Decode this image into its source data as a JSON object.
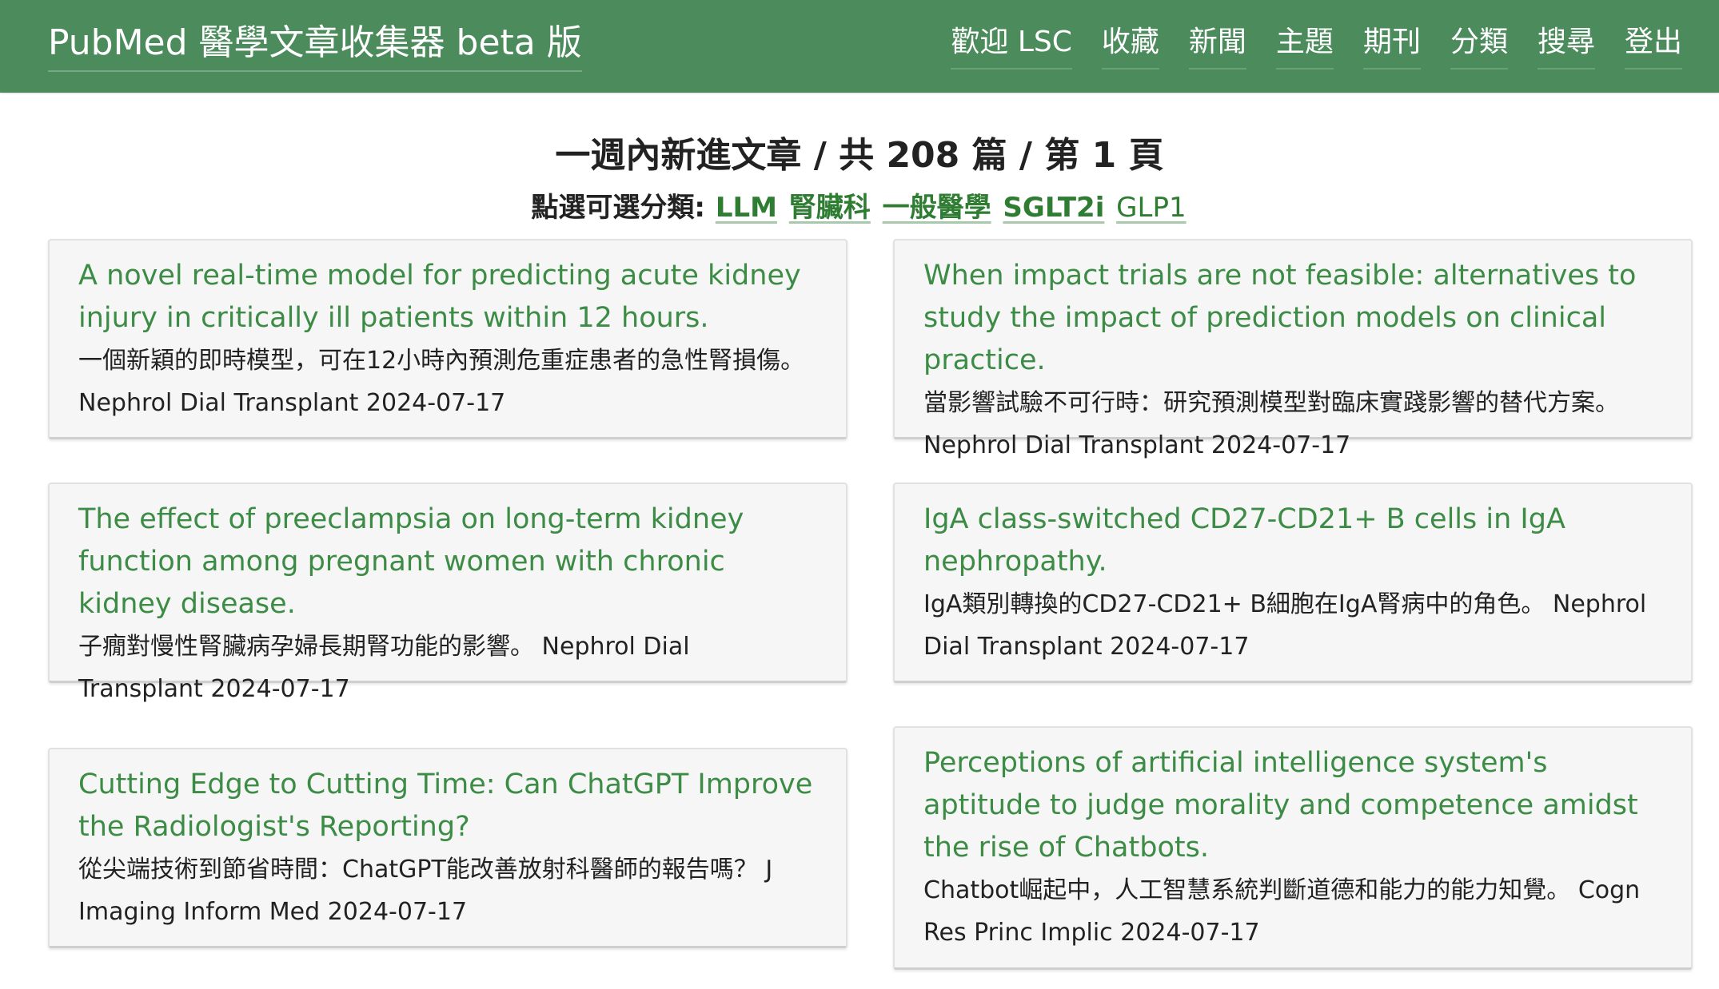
{
  "navbar": {
    "brand": "PubMed 醫學文章收集器 beta 版",
    "links": [
      "歡迎 LSC",
      "收藏",
      "新聞",
      "主題",
      "期刊",
      "分類",
      "搜尋",
      "登出"
    ]
  },
  "main": {
    "title": "一週內新進文章 / 共 208 篇 / 第 1 頁",
    "category_prefix": "點選可選分類:",
    "categories": [
      "LLM",
      "腎臟科",
      "一般醫學",
      "SGLT2i",
      "GLP1"
    ]
  },
  "articles": [
    {
      "title": "A novel real-time model for predicting acute kidney injury in critically ill patients within 12 hours.",
      "translation": "一個新穎的即時模型，可在12小時內預測危重症患者的急性腎損傷。",
      "journal": "Nephrol Dial Transplant",
      "date": "2024-07-17"
    },
    {
      "title": "When impact trials are not feasible: alternatives to study the impact of prediction models on clinical practice.",
      "translation": "當影響試驗不可行時：研究預測模型對臨床實踐影響的替代方案。",
      "journal": "Nephrol Dial Transplant",
      "date": "2024-07-17"
    },
    {
      "title": "The effect of preeclampsia on long-term kidney function among pregnant women with chronic kidney disease.",
      "translation": "子癇對慢性腎臟病孕婦長期腎功能的影響。",
      "journal": "Nephrol Dial Transplant",
      "date": "2024-07-17"
    },
    {
      "title": "IgA class-switched CD27-CD21+ B cells in IgA nephropathy.",
      "translation": "IgA類別轉換的CD27-CD21+ B細胞在IgA腎病中的角色。",
      "journal": "Nephrol Dial Transplant",
      "date": "2024-07-17"
    },
    {
      "title": "Cutting Edge to Cutting Time: Can ChatGPT Improve the Radiologist's Reporting?",
      "translation": "從尖端技術到節省時間：ChatGPT能改善放射科醫師的報告嗎？",
      "journal": "J Imaging Inform Med",
      "date": "2024-07-17"
    },
    {
      "title": "Perceptions of artificial intelligence system's aptitude to judge morality and competence amidst the rise of Chatbots.",
      "translation": "Chatbot崛起中，人工智慧系統判斷道德和能力的能力知覺。",
      "journal": "Cogn Res Princ Implic",
      "date": "2024-07-17"
    }
  ],
  "colors": {
    "navbar_bg": "#4b8b5c",
    "link_green": "#3c8c46",
    "card_bg": "#f6f6f6"
  }
}
